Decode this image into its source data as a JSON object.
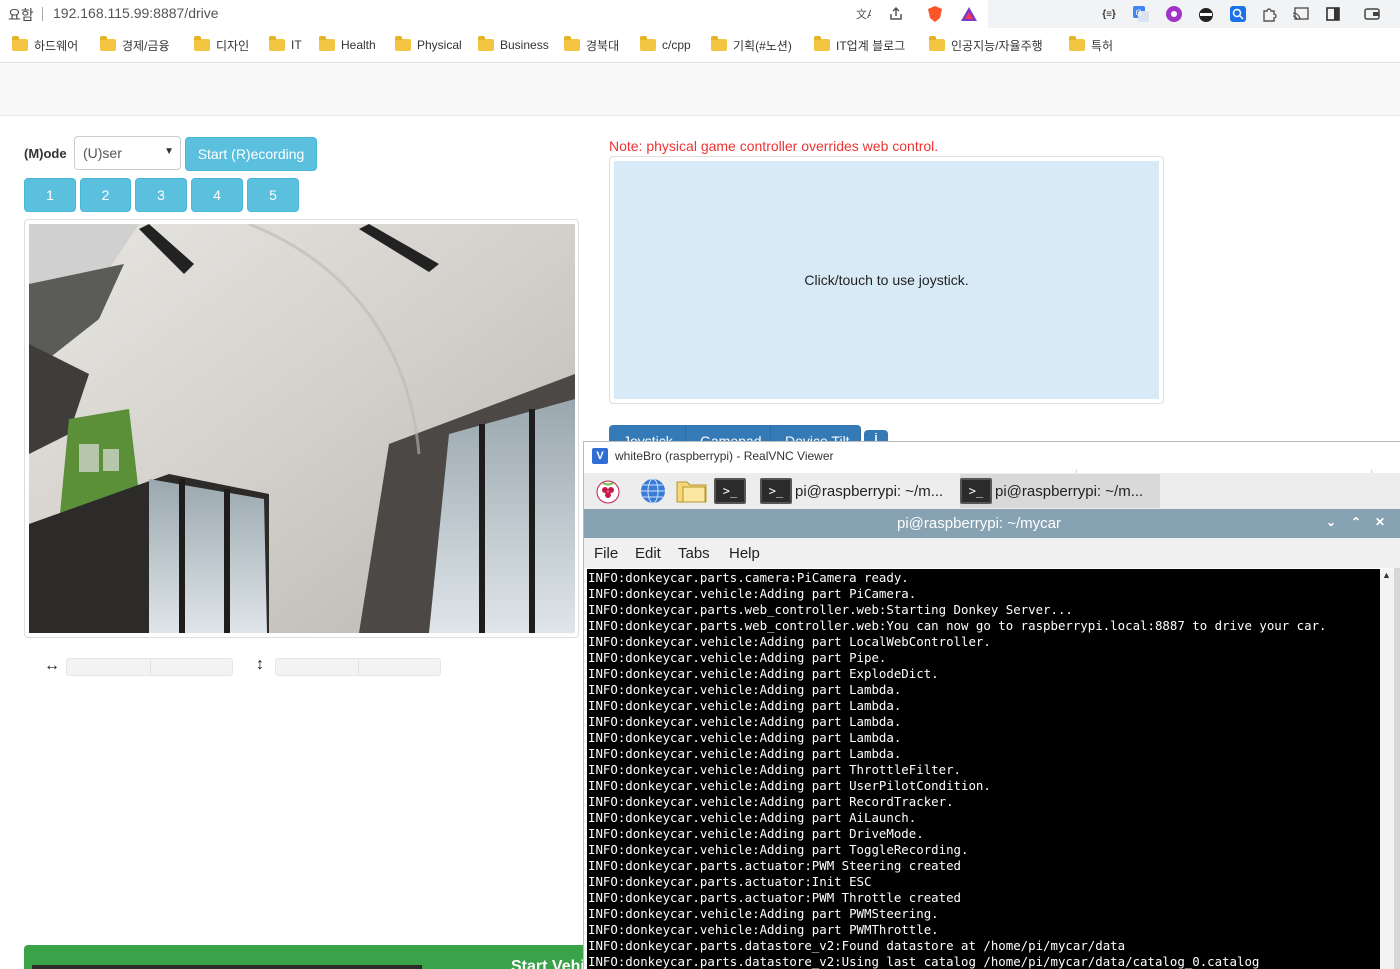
{
  "browser": {
    "security_label": "요함",
    "url": "192.168.115.99:8887/drive",
    "bookmarks": [
      "하드웨어",
      "경제/금융",
      "디자인",
      "IT",
      "Health",
      "Physical",
      "Business",
      "경북대",
      "c/cpp",
      "기획(#노션)",
      "IT업계 블로그",
      "인공지능/자율주행",
      "특허"
    ]
  },
  "page": {
    "mode_label": "(M)ode",
    "mode_value": "(U)ser",
    "record_button": "Start (R)ecording",
    "number_buttons": [
      "1",
      "2",
      "3",
      "4",
      "5"
    ],
    "note": "Note: physical game controller overrides web control.",
    "joystick_hint": "Click/touch to use joystick.",
    "control_tabs": [
      "Joystick",
      "Gamepad",
      "Device Tilt"
    ],
    "start_vehicle": "Start Vehi"
  },
  "vnc": {
    "window_title": "whiteBro (raspberrypi) - RealVNC Viewer",
    "taskbar": [
      "pi@raspberrypi: ~/m...",
      "pi@raspberrypi: ~/m..."
    ],
    "terminal_title": "pi@raspberrypi: ~/mycar",
    "menu": [
      "File",
      "Edit",
      "Tabs",
      "Help"
    ],
    "log_lines": [
      "INFO:donkeycar.parts.camera:PiCamera ready.",
      "INFO:donkeycar.vehicle:Adding part PiCamera.",
      "INFO:donkeycar.parts.web_controller.web:Starting Donkey Server...",
      "INFO:donkeycar.parts.web_controller.web:You can now go to raspberrypi.local:8887 to drive your car.",
      "INFO:donkeycar.vehicle:Adding part LocalWebController.",
      "INFO:donkeycar.vehicle:Adding part Pipe.",
      "INFO:donkeycar.vehicle:Adding part ExplodeDict.",
      "INFO:donkeycar.vehicle:Adding part Lambda.",
      "INFO:donkeycar.vehicle:Adding part Lambda.",
      "INFO:donkeycar.vehicle:Adding part Lambda.",
      "INFO:donkeycar.vehicle:Adding part Lambda.",
      "INFO:donkeycar.vehicle:Adding part Lambda.",
      "INFO:donkeycar.vehicle:Adding part ThrottleFilter.",
      "INFO:donkeycar.vehicle:Adding part UserPilotCondition.",
      "INFO:donkeycar.vehicle:Adding part RecordTracker.",
      "INFO:donkeycar.vehicle:Adding part AiLaunch.",
      "INFO:donkeycar.vehicle:Adding part DriveMode.",
      "INFO:donkeycar.vehicle:Adding part ToggleRecording.",
      "INFO:donkeycar.parts.actuator:PWM Steering created",
      "INFO:donkeycar.parts.actuator:Init ESC",
      "INFO:donkeycar.parts.actuator:PWM Throttle created",
      "INFO:donkeycar.vehicle:Adding part PWMSteering.",
      "INFO:donkeycar.vehicle:Adding part PWMThrottle.",
      "INFO:donkeycar.parts.datastore_v2:Found datastore at /home/pi/mycar/data",
      "INFO:donkeycar.parts.datastore_v2:Using last catalog /home/pi/mycar/data/catalog_0.catalog"
    ]
  },
  "colors": {
    "info_button": "#5bc0de",
    "primary_tab": "#337ab7",
    "joystick_pad": "#d8eaf6",
    "note_text": "#ee3333",
    "terminal_titlebar": "#87a2b3",
    "start_vehicle": "#3aa34a"
  }
}
